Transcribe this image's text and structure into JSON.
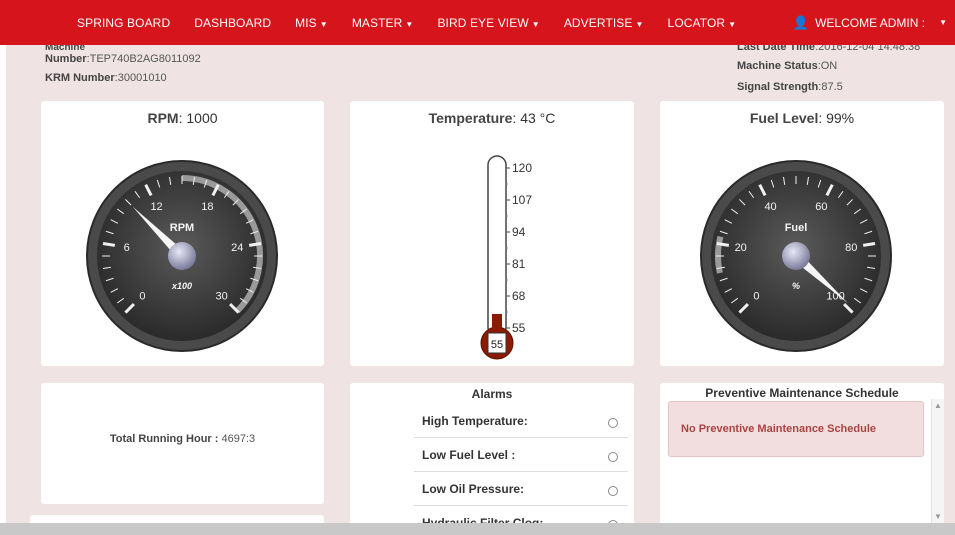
{
  "nav": {
    "items": [
      {
        "label": "SPRING BOARD",
        "caret": false
      },
      {
        "label": "DASHBOARD",
        "caret": false
      },
      {
        "label": "MIS",
        "caret": true
      },
      {
        "label": "MASTER",
        "caret": true
      },
      {
        "label": "BIRD EYE VIEW",
        "caret": true
      },
      {
        "label": "ADVERTISE",
        "caret": true
      },
      {
        "label": "LOCATOR",
        "caret": true
      }
    ],
    "welcome": "WELCOME ADMIN :"
  },
  "machine": {
    "machine_label": "Machine",
    "number_label": "Number",
    "number_value": "TEP740B2AG8011092",
    "krm_label": "KRM Number",
    "krm_value": "30001010",
    "last_date_label": "Last Date Time",
    "last_date_value": "2016-12-04 14:48:38",
    "status_label": "Machine Status",
    "status_value": "ON",
    "signal_label": "Signal Strength",
    "signal_value": "87.5"
  },
  "rpm": {
    "title_label": "RPM",
    "title_value": "1000",
    "gauge_label": "RPM",
    "unit": "x100",
    "ticks": [
      "0",
      "6",
      "12",
      "18",
      "24",
      "30"
    ],
    "value_x100": 10,
    "min": 0,
    "max": 30
  },
  "temperature": {
    "title_label": "Temperature",
    "title_value": "43 °C",
    "scale": [
      "120",
      "107",
      "94",
      "81",
      "68",
      "55"
    ],
    "bulb_value": "55",
    "value": 43
  },
  "fuel": {
    "title_label": "Fuel Level",
    "title_value": "99%",
    "gauge_label": "Fuel",
    "unit": "%",
    "ticks": [
      "0",
      "20",
      "40",
      "60",
      "80",
      "100"
    ],
    "value": 99,
    "min": 0,
    "max": 100
  },
  "running": {
    "label": "Total Running Hour :",
    "value": "4697:3"
  },
  "alarms": {
    "title": "Alarms",
    "items": [
      "High Temperature:",
      "Low Fuel Level :",
      "Low Oil Pressure:",
      "Hydraulic Filter Clog:"
    ]
  },
  "pm": {
    "title": "Preventive Maintenance Schedule",
    "message": "No Preventive Maintenance Schedule"
  },
  "colors": {
    "nav_bg": "#d6141c",
    "content_bg": "#efe3e3",
    "alert_text": "#a94442"
  }
}
